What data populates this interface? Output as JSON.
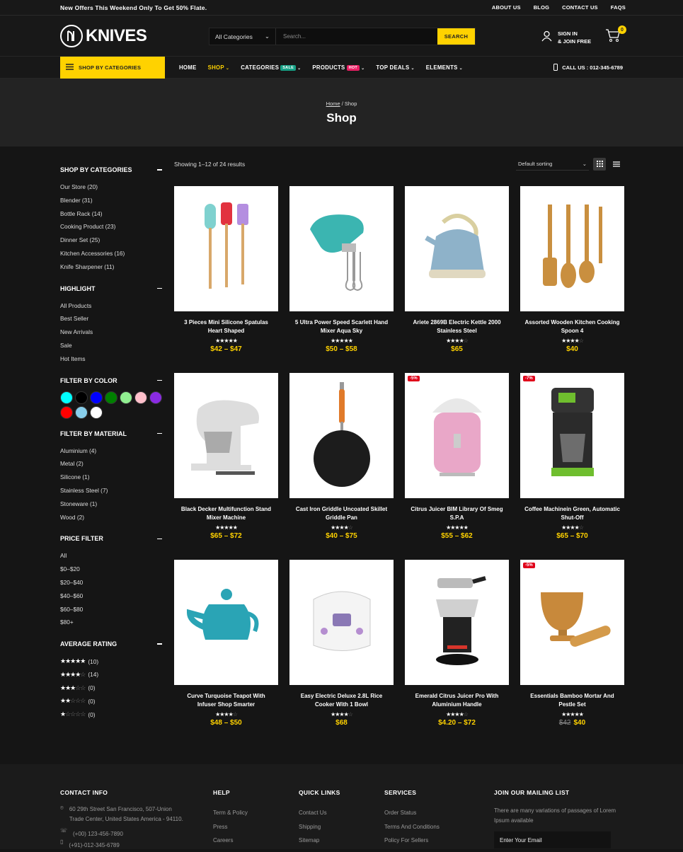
{
  "topbar": {
    "promo": "New Offers This Weekend Only To Get 50% Flate.",
    "links": [
      "ABOUT US",
      "BLOG",
      "CONTACT US",
      "FAQS"
    ]
  },
  "header": {
    "logo": "KNIVES",
    "search_category": "All Categories",
    "search_placeholder": "Search...",
    "search_button": "SEARCH",
    "signin_line1": "SIGN IN",
    "signin_line2": "& JOIN FREE",
    "cart_count": "0"
  },
  "nav": {
    "category_button": "SHOP BY CATEGORIES",
    "items": [
      {
        "label": "HOME",
        "badge": "",
        "caret": false
      },
      {
        "label": "SHOP",
        "badge": "",
        "caret": true
      },
      {
        "label": "CATEGORIES",
        "badge": "SALE",
        "caret": true
      },
      {
        "label": "PRODUCTS",
        "badge": "HOT",
        "caret": true
      },
      {
        "label": "TOP DEALS",
        "badge": "",
        "caret": true
      },
      {
        "label": "ELEMENTS",
        "badge": "",
        "caret": true
      }
    ],
    "call": "CALL US : 012-345-6789"
  },
  "hero": {
    "crumb_home": "Home",
    "crumb_sep": "/",
    "crumb_current": "Shop",
    "title": "Shop"
  },
  "sidebar": {
    "categories_title": "SHOP BY CATEGORIES",
    "categories": [
      "Our Store (20)",
      "Blender (31)",
      "Bottle Rack (14)",
      "Cooking Product (23)",
      "Dinner Set (25)",
      "Kitchen Accessories (16)",
      "Knife Sharpener (11)"
    ],
    "highlight_title": "HIGHLIGHT",
    "highlight": [
      "All Products",
      "Best Seller",
      "New Arrivals",
      "Sale",
      "Hot Items"
    ],
    "color_title": "FILTER BY COLOR",
    "colors": [
      "#00ffff",
      "#000000",
      "#0000ff",
      "#008000",
      "#90ee90",
      "#ffc0cb",
      "#8a2be2",
      "#ff0000",
      "#87ceeb",
      "#ffffff"
    ],
    "material_title": "FILTER BY MATERIAL",
    "materials": [
      "Aluminium (4)",
      "Metal (2)",
      "Silicone (1)",
      "Stainless Steel (7)",
      "Stoneware (1)",
      "Wood (2)"
    ],
    "price_title": "PRICE FILTER",
    "prices": [
      "All",
      "$0–$20",
      "$20–$40",
      "$40–$60",
      "$60–$80",
      "$80+"
    ],
    "rating_title": "AVERAGE RATING",
    "ratings": [
      {
        "stars": 5,
        "count": "(10)"
      },
      {
        "stars": 4,
        "count": "(14)"
      },
      {
        "stars": 3,
        "count": "(0)"
      },
      {
        "stars": 2,
        "count": "(0)"
      },
      {
        "stars": 1,
        "count": "(0)"
      }
    ]
  },
  "toolbar": {
    "results": "Showing 1–12 of 24 results",
    "sort": "Default sorting"
  },
  "products": [
    {
      "name": "3 Pieces Mini Silicone Spatulas Heart Shaped",
      "stars": 5,
      "price": "$42 – $47",
      "old": "",
      "discount": "",
      "icon": "spatula-icon"
    },
    {
      "name": "5 Ultra Power Speed Scarlett Hand Mixer Aqua Sky",
      "stars": 5,
      "price": "$50 – $58",
      "old": "",
      "discount": "",
      "icon": "hand-mixer-icon"
    },
    {
      "name": "Ariete 2869B Electric Kettle 2000 Stainless Steel",
      "stars": 4,
      "price": "$65",
      "old": "",
      "discount": "",
      "icon": "kettle-icon"
    },
    {
      "name": "Assorted Wooden Kitchen Cooking Spoon 4",
      "stars": 4,
      "price": "$40",
      "old": "",
      "discount": "",
      "icon": "wooden-spoon-icon"
    },
    {
      "name": "Black Decker Multifunction Stand Mixer Machine",
      "stars": 5,
      "price": "$65 – $72",
      "old": "",
      "discount": "",
      "icon": "stand-mixer-icon"
    },
    {
      "name": "Cast Iron Griddle Uncoated Skillet Griddle Pan",
      "stars": 4,
      "price": "$40 – $75",
      "old": "",
      "discount": "",
      "icon": "griddle-pan-icon"
    },
    {
      "name": "Citrus Juicer BIM Library Of Smeg S.P.A",
      "stars": 5,
      "price": "$55 – $62",
      "old": "",
      "discount": "-5%",
      "icon": "citrus-juicer-icon"
    },
    {
      "name": "Coffee Machinein Green, Automatic Shut-Off",
      "stars": 4,
      "price": "$65 – $70",
      "old": "",
      "discount": "-7%",
      "icon": "coffee-machine-icon"
    },
    {
      "name": "Curve Turquoise Teapot With Infuser Shop Smarter",
      "stars": 4,
      "price": "$48 – $50",
      "old": "",
      "discount": "",
      "icon": "teapot-icon"
    },
    {
      "name": "Easy Electric Deluxe 2.8L Rice Cooker With 1 Bowl",
      "stars": 4,
      "price": "$68",
      "old": "",
      "discount": "",
      "icon": "rice-cooker-icon"
    },
    {
      "name": "Emerald Citrus Juicer Pro With Aluminium Handle",
      "stars": 4,
      "price": "$4.20 – $72",
      "old": "",
      "discount": "",
      "icon": "juicer-pro-icon"
    },
    {
      "name": "Essentials Bamboo Mortar And Pestle Set",
      "stars": 5,
      "price": "$40",
      "old": "$42",
      "discount": "-5%",
      "icon": "mortar-pestle-icon"
    }
  ],
  "footer": {
    "contact_title": "CONTACT INFO",
    "address": "60 29th Street San Francisco, 507-Union Trade Center, United States America - 94110.",
    "phone1": "(+00) 123-456-7890",
    "phone2": "(+91)-012-345-6789",
    "help_title": "HELP",
    "help": [
      "Term & Policy",
      "Press",
      "Careers"
    ],
    "quick_title": "QUICK LINKS",
    "quick": [
      "Contact Us",
      "Shipping",
      "Sitemap"
    ],
    "services_title": "SERVICES",
    "services": [
      "Order Status",
      "Terms And Conditions",
      "Policy For Sellers"
    ],
    "mailing_title": "JOIN OUR MAILING LIST",
    "mailing_text": "There are many variations of passages of Lorem Ipsum available",
    "email_placeholder": "Enter Your Email"
  }
}
